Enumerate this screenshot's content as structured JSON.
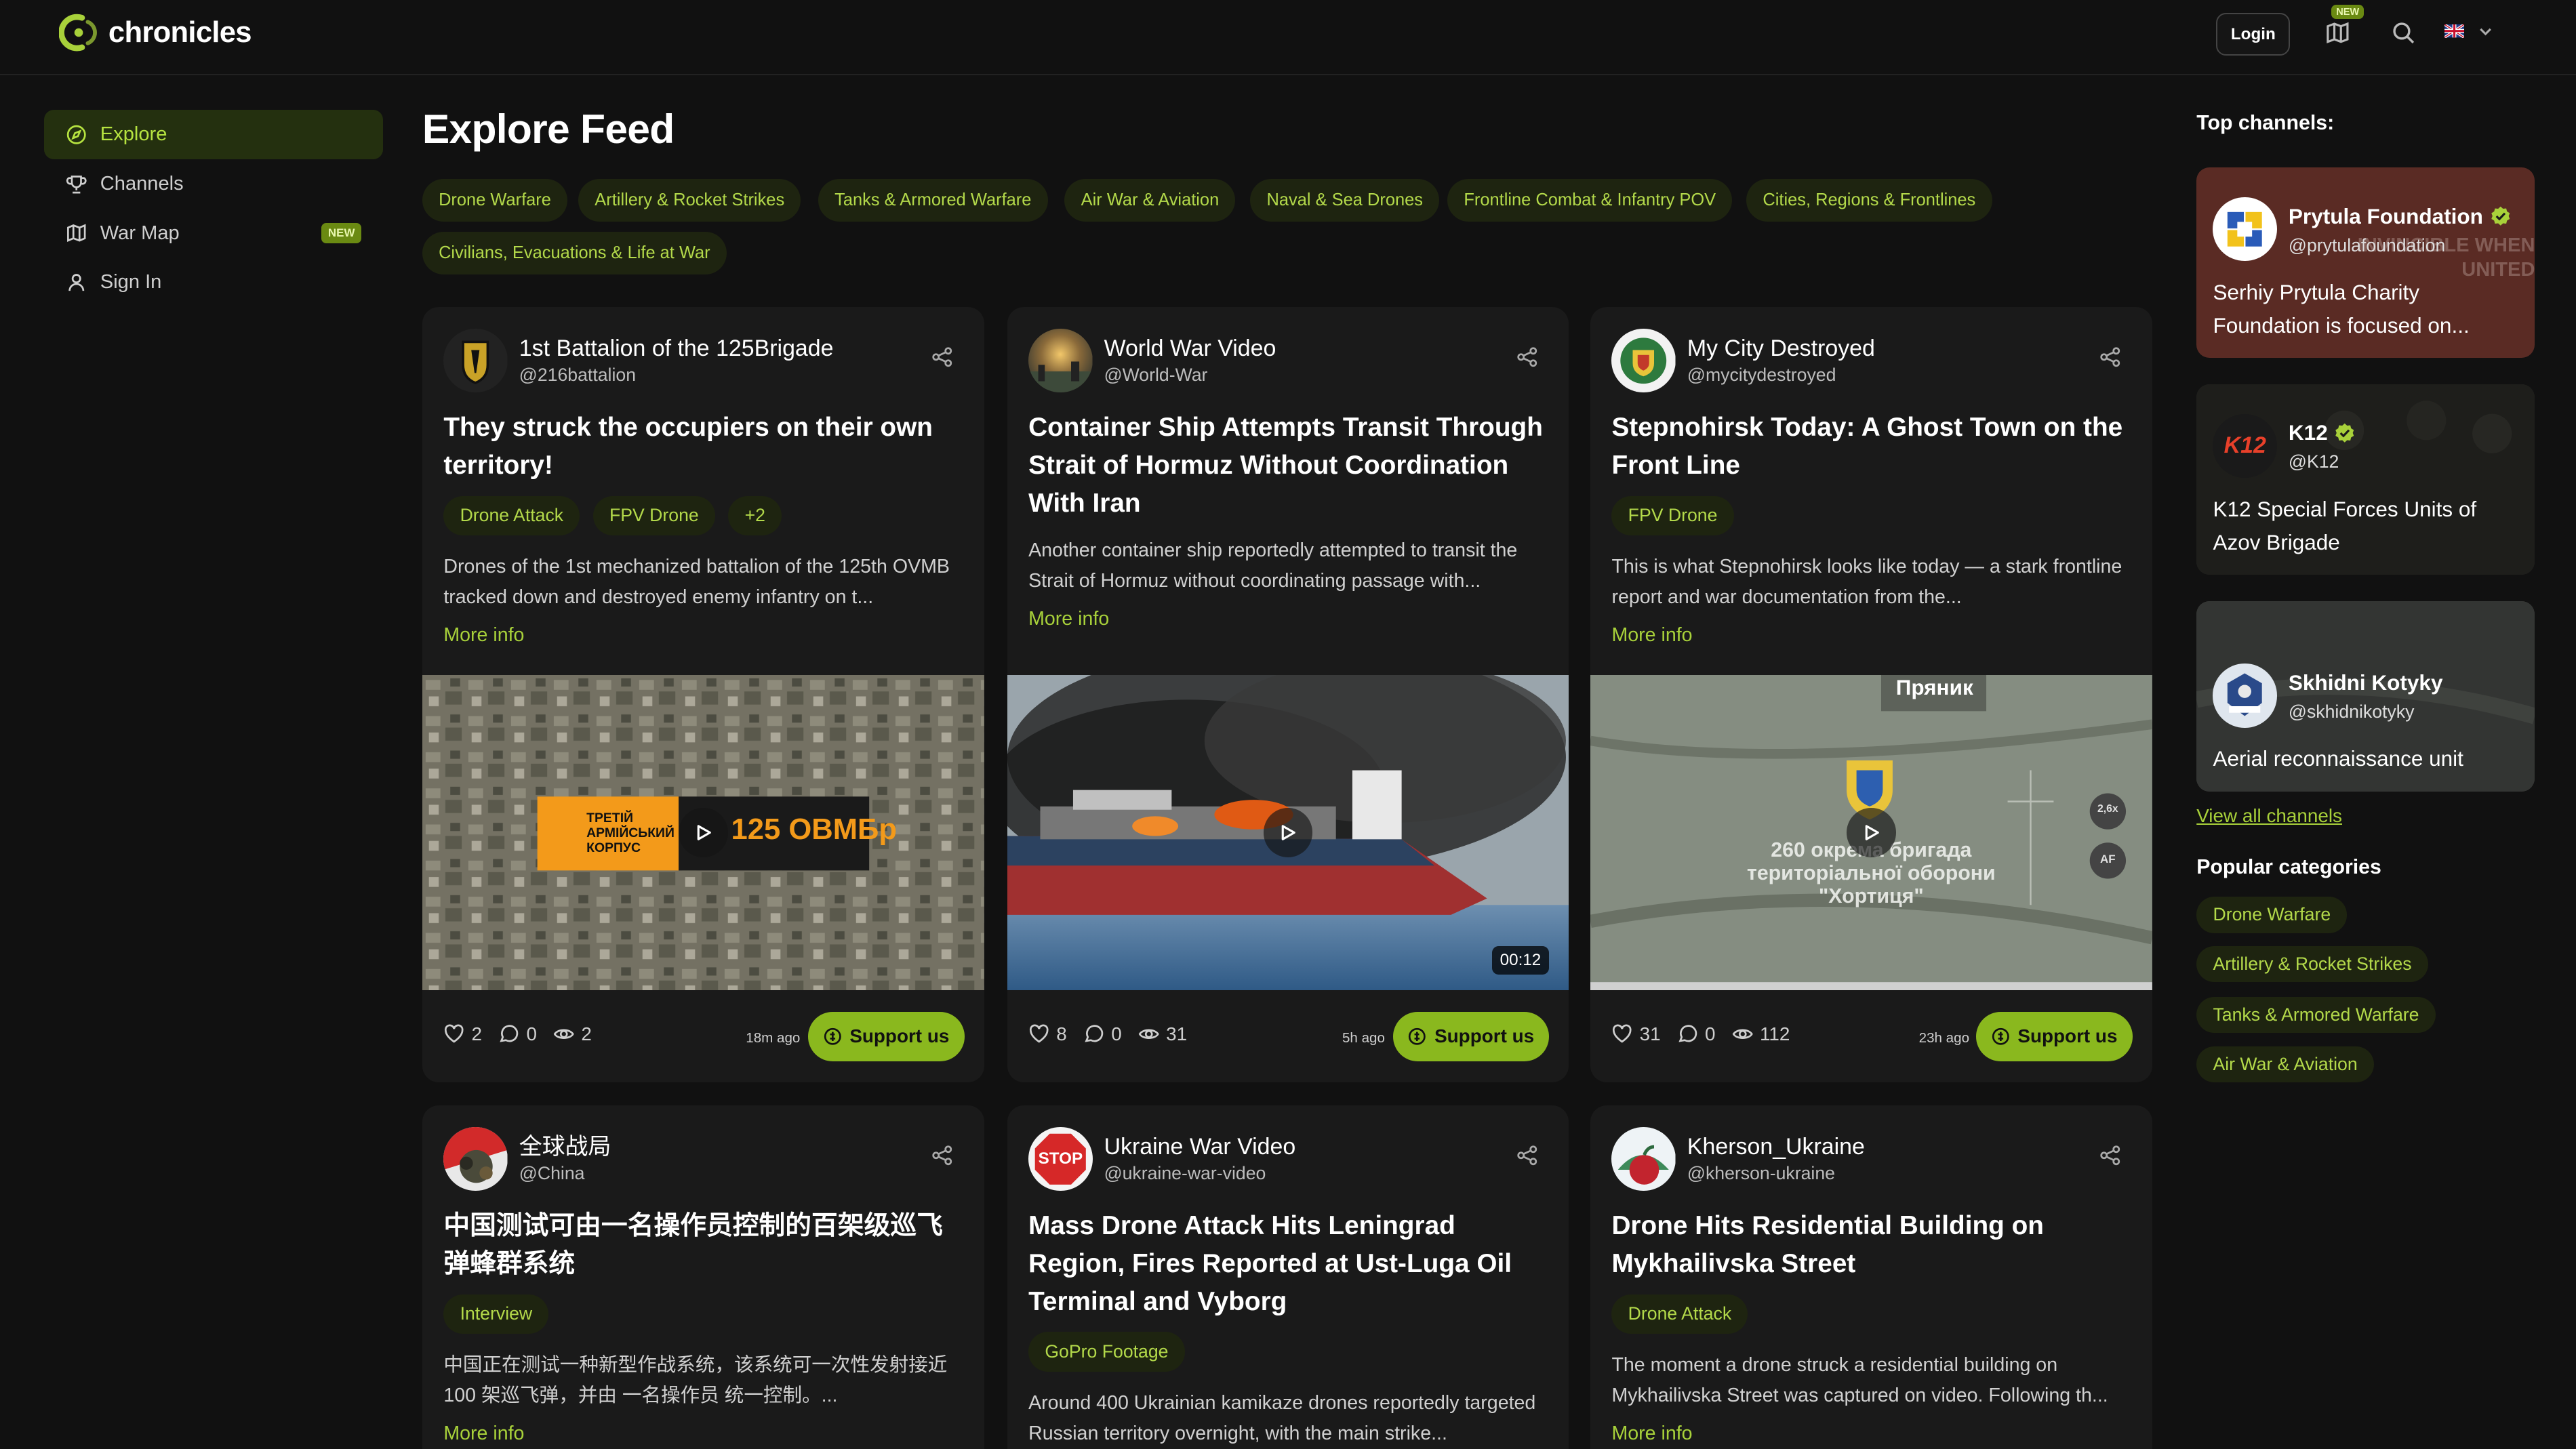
{
  "header": {
    "brand": "chronicles",
    "login_label": "Login",
    "map_badge": "NEW",
    "colors": {
      "accent": "#a8d13a",
      "bg": "#111111"
    }
  },
  "sidebar": {
    "items": [
      {
        "label": "Explore",
        "icon": "compass-icon"
      },
      {
        "label": "Channels",
        "icon": "trophy-icon"
      },
      {
        "label": "War Map",
        "icon": "map-icon",
        "badge": "NEW"
      },
      {
        "label": "Sign In",
        "icon": "user-icon"
      }
    ]
  },
  "main": {
    "title": "Explore Feed",
    "categories": [
      "Drone Warfare",
      "Artillery & Rocket Strikes",
      "Tanks & Armored Warfare",
      "Air War & Aviation",
      "Naval & Sea Drones",
      "Frontline Combat & Infantry POV",
      "Cities, Regions & Frontlines",
      "Civilians, Evacuations & Life at War"
    ]
  },
  "cards": [
    {
      "name": "1st Battalion of the 125Brigade",
      "handle": "@216battalion",
      "title": "They struck the occupiers on their own territory!",
      "tags": [
        "Drone Attack",
        "FPV Drone",
        "+2"
      ],
      "desc": "Drones of the 1st mechanized battalion of the 125th OVMB tracked down and destroyed enemy infantry on t...",
      "more": "More info",
      "overlay_left": "ТРЕТІЙ АРМІЙСЬКИЙ КОРПУС",
      "overlay_right": "125 ОВМБр",
      "likes": "2",
      "comments": "0",
      "views": "2",
      "age": "18m ago",
      "support": "Support us"
    },
    {
      "name": "World War Video",
      "handle": "@World-War",
      "title": "Container Ship Attempts Transit Through Strait of Hormuz Without Coordination With Iran",
      "tags": [],
      "desc": "Another container ship reportedly attempted to transit the Strait of Hormuz without coordinating passage with...",
      "more": "More info",
      "duration": "00:12",
      "likes": "8",
      "comments": "0",
      "views": "31",
      "age": "5h ago",
      "support": "Support us"
    },
    {
      "name": "My City Destroyed",
      "handle": "@mycitydestroyed",
      "title": "Stepnohirsk Today: A Ghost Town on the Front Line",
      "tags": [
        "FPV Drone"
      ],
      "desc": "This is what Stepnohirsk looks like today — a stark frontline report and war documentation from the...",
      "more": "More info",
      "overlay_top": "Пряник",
      "overlay_text": "260 окрема бригада територіальної оборони \"Хортиця\"",
      "hud": [
        "2,6x",
        "AF"
      ],
      "likes": "31",
      "comments": "0",
      "views": "112",
      "age": "23h ago",
      "support": "Support us"
    },
    {
      "name": "全球战局",
      "handle": "@China",
      "title": "中国测试可由一名操作员控制的百架级巡飞弹蜂群系统",
      "tags": [
        "Interview"
      ],
      "desc": "中国正在测试一种新型作战系统，该系统可一次性发射接近 100 架巡飞弹，并由 一名操作员 统一控制。...",
      "more": "More info"
    },
    {
      "name": "Ukraine War Video",
      "handle": "@ukraine-war-video",
      "avatar_text": "STOP",
      "title": "Mass Drone Attack Hits Leningrad Region, Fires Reported at Ust-Luga Oil Terminal and Vyborg",
      "tags": [
        "GoPro Footage"
      ],
      "desc": "Around 400 Ukrainian kamikaze drones reportedly targeted Russian territory overnight, with the main strike...",
      "more": "More info"
    },
    {
      "name": "Kherson_Ukraine",
      "handle": "@kherson-ukraine",
      "title": "Drone Hits Residential Building on Mykhailivska Street",
      "tags": [
        "Drone Attack"
      ],
      "desc": "The moment a drone struck a residential building on Mykhailivska Street was captured on video. Following th...",
      "more": "More info"
    }
  ],
  "right": {
    "title": "Top channels:",
    "channels": [
      {
        "name": "Prytula Foundation",
        "handle": "@prytulafoundation",
        "desc": "Serhiy Prytula Charity Foundation is focused on...",
        "verified": true,
        "bg_text": "INVINCIBLE WHEN UNITED"
      },
      {
        "name": "K12",
        "handle": "@K12",
        "desc": "K12 Special Forces Units of Azov Brigade",
        "verified": true,
        "avatar_text": "K12"
      },
      {
        "name": "Skhidni Kotyky",
        "handle": "@skhidnikotyky",
        "desc": "Aerial reconnaissance unit",
        "verified": false
      }
    ],
    "view_all": "View all channels",
    "popular_title": "Popular categories",
    "popular": [
      "Drone Warfare",
      "Artillery & Rocket Strikes",
      "Tanks & Armored Warfare",
      "Air War & Aviation"
    ]
  }
}
